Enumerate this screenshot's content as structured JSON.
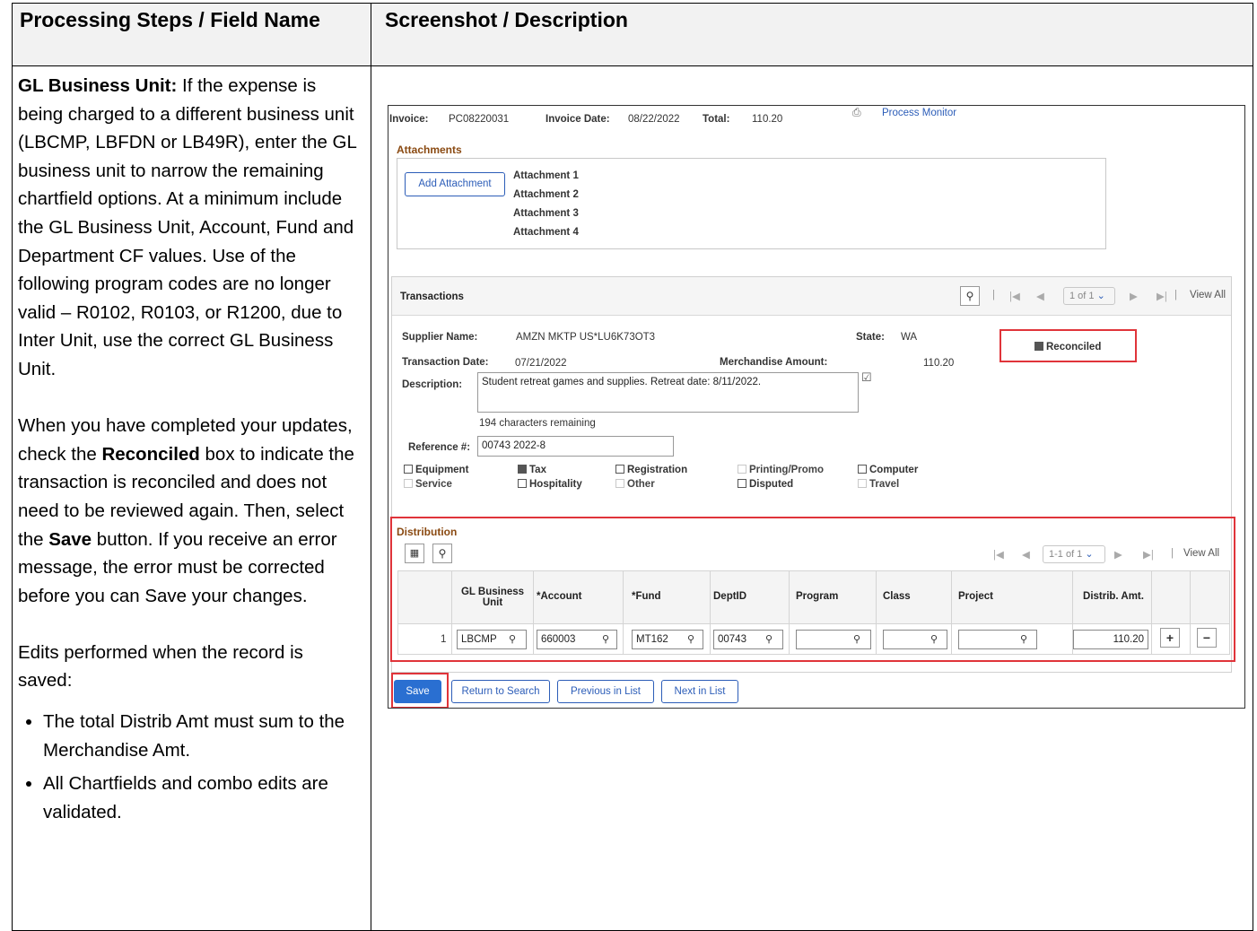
{
  "header": {
    "col1": "Processing Steps / Field Name",
    "col2": "Screenshot / Description"
  },
  "left": {
    "p1_bold": "GL Business Unit:",
    "p1": " If the expense is being charged to a different business unit (LBCMP, LBFDN or LB49R), enter the GL business unit to narrow the remaining chartfield options.  At a minimum include the GL Business Unit, Account, Fund and Department CF values. Use of the following program codes are no longer valid – R0102, R0103, or R1200, due to Inter Unit, use the correct GL Business Unit.",
    "p2_a": "When you have completed your updates, check the ",
    "p2_b": "Reconciled",
    "p2_c": " box to indicate the transaction is reconciled and does not need to be reviewed again. Then, select the ",
    "p2_d": "Save",
    "p2_e": " button.  If you receive an error message, the error must be corrected before you can Save your changes.",
    "p3": "Edits performed when the record is saved:",
    "bullets": [
      "The total Distrib Amt must sum to the Merchandise Amt.",
      "All Chartfields and combo edits are validated."
    ]
  },
  "shot": {
    "invoice_label": "Invoice:",
    "invoice_value": "PC08220031",
    "invoice_date_label": "Invoice Date:",
    "invoice_date_value": "08/22/2022",
    "total_label": "Total:",
    "total_value": "110.20",
    "process_monitor": "Process Monitor",
    "attachments_title": "Attachments",
    "add_attachment": "Add Attachment",
    "attachments": [
      "Attachment 1",
      "Attachment 2",
      "Attachment 3",
      "Attachment 4"
    ],
    "transactions_title": "Transactions",
    "nav_page": "1 of 1",
    "view_all": "View All",
    "supplier_label": "Supplier Name:",
    "supplier_value": "AMZN MKTP US*LU6K73OT3",
    "state_label": "State:",
    "state_value": "WA",
    "reconciled": "Reconciled",
    "trans_date_label": "Transaction Date:",
    "trans_date_value": "07/21/2022",
    "merch_label": "Merchandise Amount:",
    "merch_value": "110.20",
    "desc_label": "Description:",
    "desc_value": "Student retreat games and supplies. Retreat date: 8/11/2022.",
    "chars_remaining": "194 characters remaining",
    "ref_label": "Reference #:",
    "ref_value": "00743 2022-8",
    "checkboxes": {
      "equipment": "Equipment",
      "service": "Service",
      "tax": "Tax",
      "hospitality": "Hospitality",
      "registration": "Registration",
      "other": "Other",
      "printing": "Printing/Promo",
      "disputed": "Disputed",
      "computer": "Computer",
      "travel": "Travel"
    },
    "distribution_title": "Distribution",
    "dist_nav_page": "1-1 of 1",
    "dist_view_all": "View All",
    "cols": {
      "gl_bu": "GL Business Unit",
      "account": "*Account",
      "fund": "*Fund",
      "dept": "DeptID",
      "program": "Program",
      "class": "Class",
      "project": "Project",
      "amt": "Distrib. Amt."
    },
    "row": {
      "num": "1",
      "gl_bu": "LBCMP",
      "account": "660003",
      "fund": "MT162",
      "dept": "00743",
      "program": "",
      "class": "",
      "project": "",
      "amt": "110.20"
    },
    "buttons": {
      "save": "Save",
      "return": "Return to Search",
      "previous": "Previous in List",
      "next": "Next in List"
    }
  }
}
